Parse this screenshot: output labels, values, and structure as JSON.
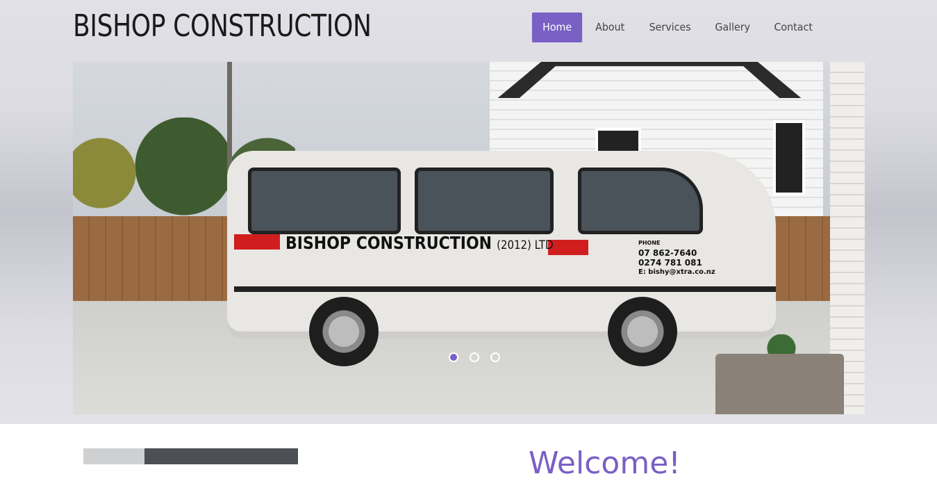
{
  "header": {
    "logo": "BISHOP CONSTRUCTION"
  },
  "nav": {
    "items": [
      {
        "label": "Home",
        "active": true
      },
      {
        "label": "About",
        "active": false
      },
      {
        "label": "Services",
        "active": false
      },
      {
        "label": "Gallery",
        "active": false
      },
      {
        "label": "Contact",
        "active": false
      }
    ]
  },
  "hero": {
    "van_name": "BISHOP CONSTRUCTION",
    "van_suffix": "(2012) LTD",
    "van_phone_label": "PHONE",
    "van_phone_1": "07 862-7640",
    "van_phone_2": "0274 781 081",
    "van_email": "E: bishy@xtra.co.nz",
    "slide_count": 3,
    "active_slide": 1
  },
  "welcome": {
    "title": "Welcome!"
  },
  "colors": {
    "accent": "#7a5fc5",
    "text": "#1a1a1a"
  }
}
